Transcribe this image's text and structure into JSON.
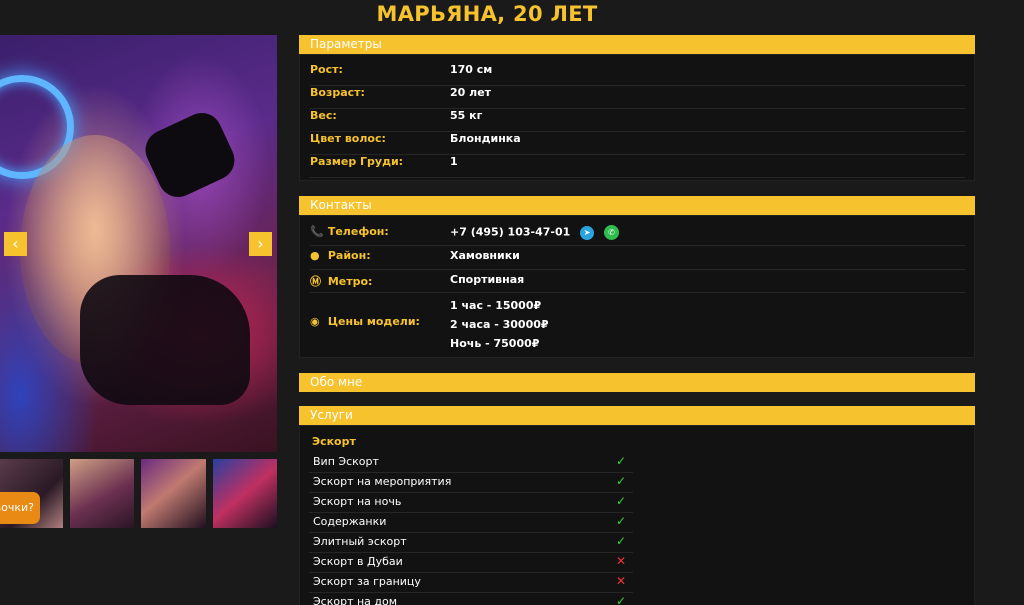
{
  "title": "МАРЬЯНА, 20 ЛЕТ",
  "gallery": {
    "prev_icon": "chevron-left-icon",
    "next_icon": "chevron-right-icon",
    "prev_glyph": "‹",
    "next_glyph": "›",
    "chat_button": "вочки?"
  },
  "params": {
    "heading": "Параметры",
    "rows": [
      {
        "label": "Рост:",
        "value": "170 см"
      },
      {
        "label": "Возраст:",
        "value": "20 лет"
      },
      {
        "label": "Вес:",
        "value": "55 кг"
      },
      {
        "label": "Цвет волос:",
        "value": "Блондинка"
      },
      {
        "label": "Размер Груди:",
        "value": "1"
      }
    ]
  },
  "contacts": {
    "heading": "Контакты",
    "phone_label": "Телефон:",
    "phone_value": "+7 (495) 103-47-01",
    "district_label": "Район:",
    "district_value": "Хамовники",
    "metro_label": "Метро:",
    "metro_value": "Спортивная",
    "prices_label": "Цены модели:",
    "prices": [
      "1 час - 15000₽",
      "2 часа - 30000₽",
      "Ночь - 75000₽"
    ],
    "icons": {
      "phone": "📞",
      "district": "●",
      "metro": "Ⓜ",
      "prices": "◉",
      "telegram": "➤",
      "whatsapp": "✆"
    }
  },
  "about": {
    "heading": "Обо мне"
  },
  "services": {
    "heading": "Услуги",
    "category": "Эскорт",
    "items": [
      {
        "name": "Вип Эскорт",
        "available": true
      },
      {
        "name": "Эскорт на мероприятия",
        "available": true
      },
      {
        "name": "Эскорт на ночь",
        "available": true
      },
      {
        "name": "Содержанки",
        "available": true
      },
      {
        "name": "Элитный эскорт",
        "available": true
      },
      {
        "name": "Эскорт в Дубаи",
        "available": false
      },
      {
        "name": "Эскорт за границу",
        "available": false
      },
      {
        "name": "Эскорт на дом",
        "available": true
      }
    ],
    "yes_glyph": "✓",
    "no_glyph": "✕"
  },
  "colors": {
    "accent": "#f6c22d",
    "background": "#1a1a1a",
    "panel": "#121212",
    "yes": "#3ad43a",
    "no": "#ee3333",
    "chat": "#e88a14"
  }
}
